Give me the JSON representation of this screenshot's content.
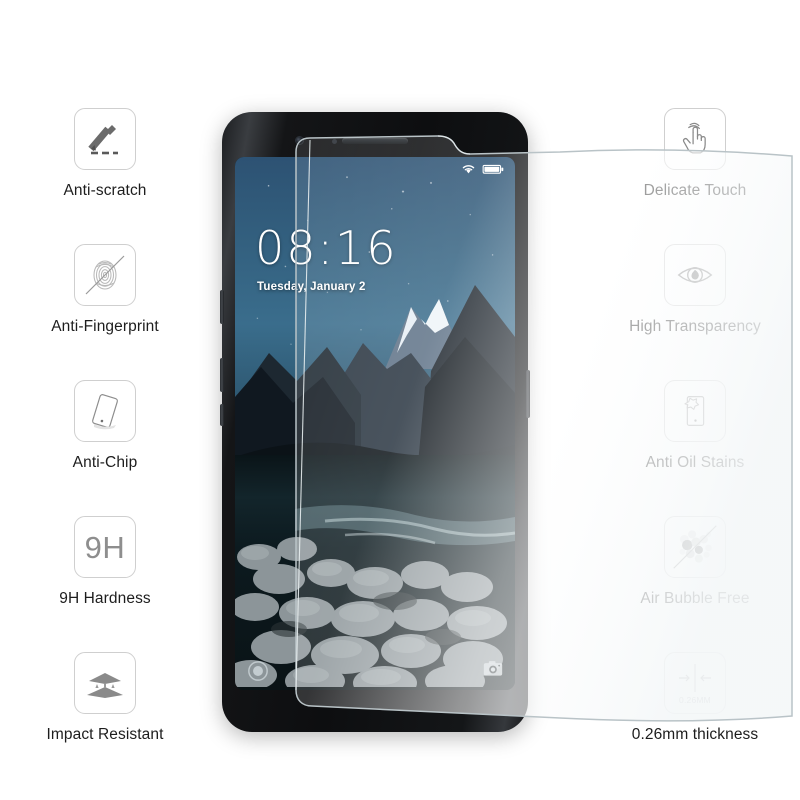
{
  "background_color": "#ffffff",
  "features_left": [
    {
      "id": "anti-scratch",
      "label": "Anti-scratch",
      "icon": "pencil-scratch-icon"
    },
    {
      "id": "anti-fingerprint",
      "label": "Anti-Fingerprint",
      "icon": "fingerprint-crossed-icon"
    },
    {
      "id": "anti-chip",
      "label": "Anti-Chip",
      "icon": "tilted-phone-icon"
    },
    {
      "id": "9h-hardness",
      "label": "9H Hardness",
      "icon": "hardness-9h-icon",
      "icon_text": "9H"
    },
    {
      "id": "impact-resistant",
      "label": "Impact Resistant",
      "icon": "layered-shield-icon"
    }
  ],
  "features_right": [
    {
      "id": "delicate-touch",
      "label": "Delicate Touch",
      "icon": "touch-hand-icon"
    },
    {
      "id": "high-transparency",
      "label": "High Transparency",
      "icon": "eye-icon"
    },
    {
      "id": "anti-oil-stains",
      "label": "Anti Oil Stains",
      "icon": "phone-oil-drop-icon"
    },
    {
      "id": "air-bubble-free",
      "label": "Air Bubble Free",
      "icon": "bubbles-crossed-icon"
    },
    {
      "id": "thickness",
      "label": "0.26mm thickness",
      "icon": "thickness-arrows-icon",
      "icon_text": "0.26MM"
    }
  ],
  "phone": {
    "lockscreen": {
      "time": "08:16",
      "date": "Tuesday, January 2",
      "wallpaper_description": "Night mountain landscape with starry sky, snow-capped peak, river and boulders",
      "status_icons": [
        "wifi-icon",
        "battery-icon"
      ],
      "bottom_left_icon": "lock-ring-icon",
      "bottom_right_icon": "camera-icon"
    },
    "hardware": {
      "front_camera": "front-camera-icon",
      "proximity_sensor": "proximity-sensor-icon",
      "earpiece": "earpiece-speaker-icon",
      "buttons": [
        "volume-up-button",
        "volume-down-button",
        "silent-switch-button",
        "power-button"
      ]
    }
  },
  "overlay": {
    "name": "tempered-glass-film",
    "description": "Transparent tempered glass screen protector peeling off toward the right"
  },
  "colors": {
    "label_text": "#1d1d1d",
    "icon_stroke": "#7d7d7d",
    "icon_border": "#cfcfcf",
    "hardness_text": "#8e8e8e",
    "thickness_text": "#8a8a8a"
  }
}
